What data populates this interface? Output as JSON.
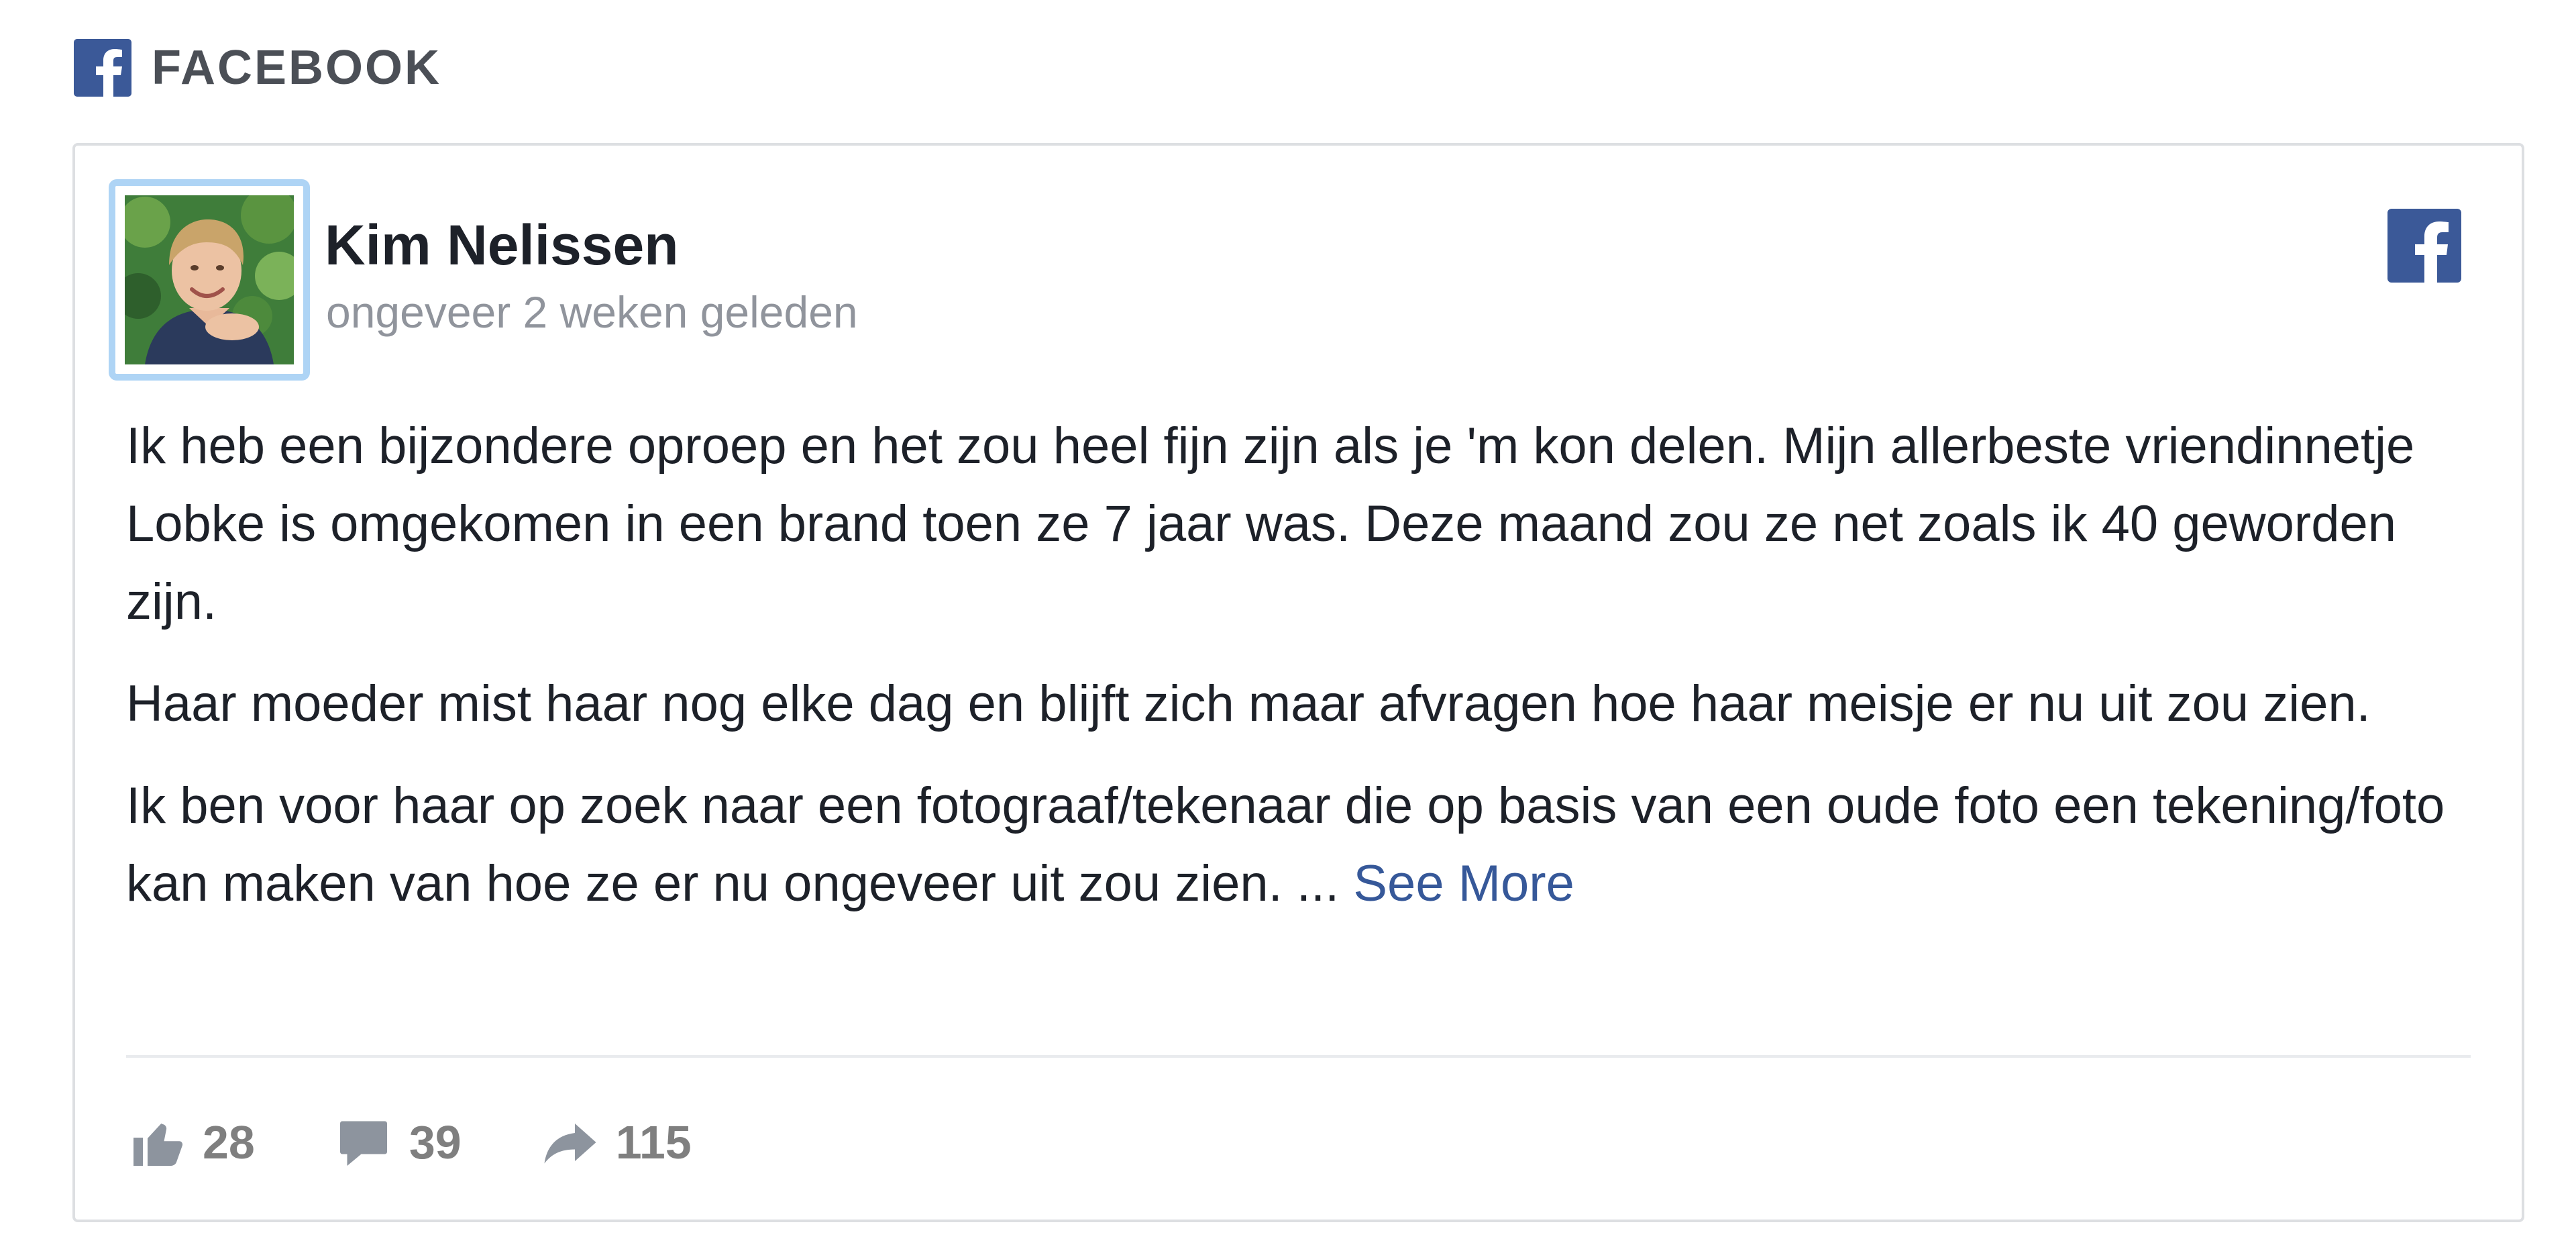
{
  "header": {
    "brand_label": "FACEBOOK",
    "brand_icon": "facebook-f-icon"
  },
  "post": {
    "author_name": "Kim Nelissen",
    "timestamp": "ongeveer 2 weken geleden",
    "paragraphs": [
      "Ik heb een bijzondere oproep en het zou heel fijn zijn als je 'm kon delen. Mijn allerbeste vriendinnetje Lobke is omgekomen in een brand toen ze 7 jaar was. Deze maand zou ze net zoals ik 40 geworden zijn.",
      "Haar moeder mist haar nog elke dag en blijft zich maar afvragen hoe haar meisje er nu uit zou zien.",
      "Ik ben voor haar op zoek naar een fotograaf/tekenaar die op basis van een oude foto een tekening/foto kan maken van hoe ze er nu ongeveer uit zou zien. ..."
    ],
    "see_more_label": "See More"
  },
  "stats": {
    "likes": "28",
    "comments": "39",
    "shares": "115"
  },
  "colors": {
    "facebook_blue": "#3b5998",
    "link_blue": "#365899",
    "muted_gray": "#90949c",
    "avatar_border": "#aed4f5"
  }
}
